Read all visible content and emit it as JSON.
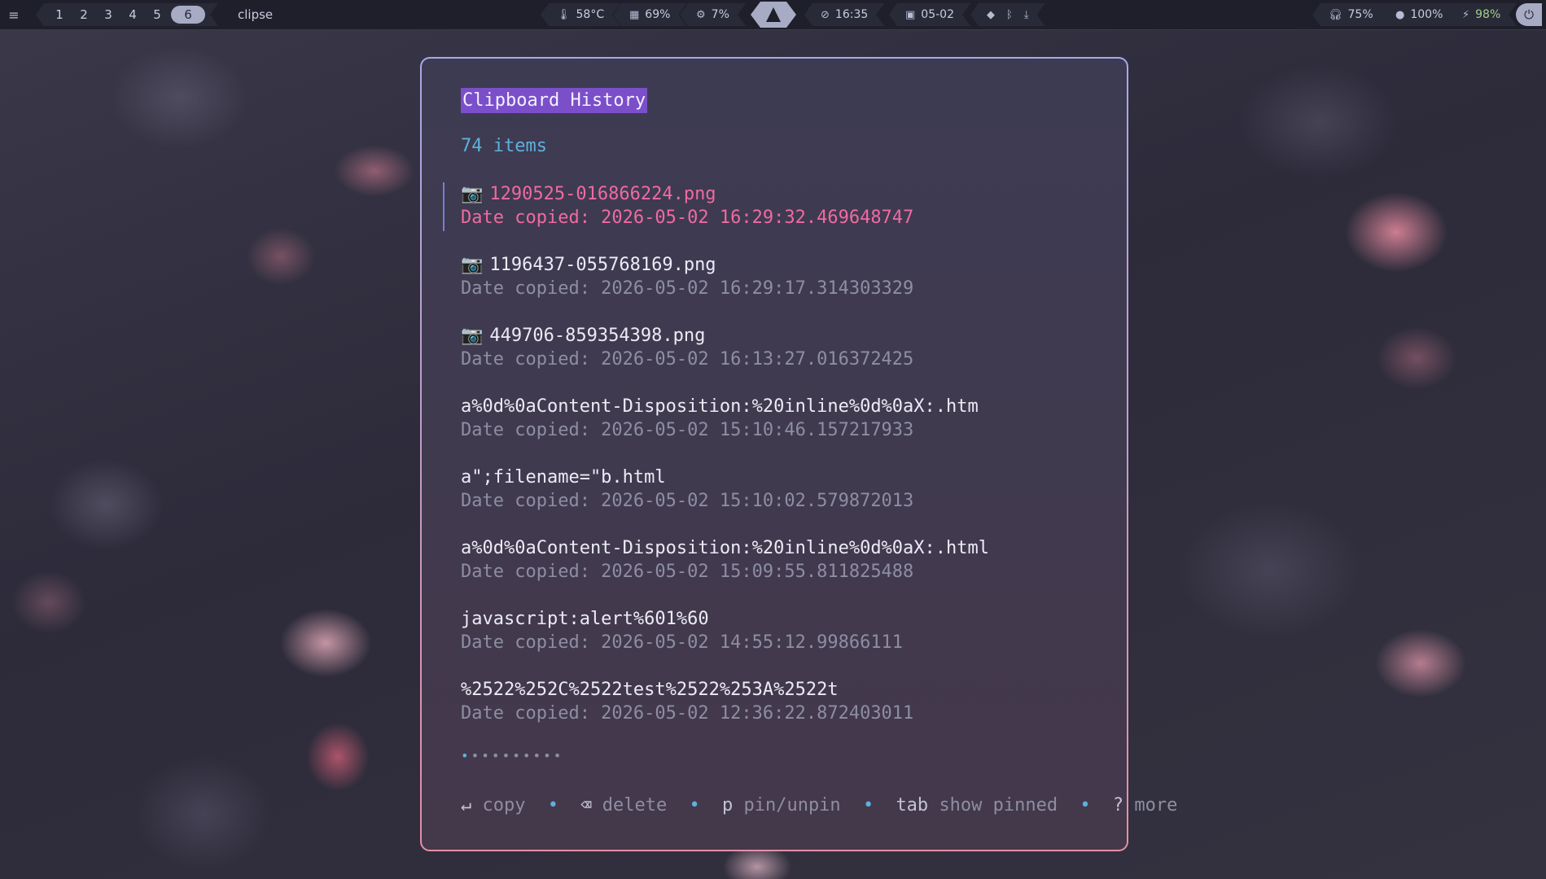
{
  "topbar": {
    "menu_icon": "hamburger-menu-icon",
    "workspaces": [
      "1",
      "2",
      "3",
      "4",
      "5",
      "6"
    ],
    "active_workspace": "6",
    "window_title": "clipse",
    "temperature": "58°C",
    "memory": "69%",
    "cpu": "7%",
    "time": "16:35",
    "date": "05-02",
    "headphones": "75%",
    "volume": "100%",
    "battery": "98%"
  },
  "clipboard": {
    "title": "Clipboard History",
    "count_label": "74 items",
    "entries": [
      {
        "icon": "📷",
        "text": "1290525-016866224.png",
        "date": "Date copied: 2026-05-02 16:29:32.469648747",
        "selected": true
      },
      {
        "icon": "📷",
        "text": "1196437-055768169.png",
        "date": "Date copied: 2026-05-02 16:29:17.314303329"
      },
      {
        "icon": "📷",
        "text": "449706-859354398.png",
        "date": "Date copied: 2026-05-02 16:13:27.016372425"
      },
      {
        "icon": "",
        "text": "a%0d%0aContent-Disposition:%20inline%0d%0aX:.htm",
        "date": "Date copied: 2026-05-02 15:10:46.157217933"
      },
      {
        "icon": "",
        "text": "a\";filename=\"b.html",
        "date": "Date copied: 2026-05-02 15:10:02.579872013"
      },
      {
        "icon": "",
        "text": "a%0d%0aContent-Disposition:%20inline%0d%0aX:.html",
        "date": "Date copied: 2026-05-02 15:09:55.811825488"
      },
      {
        "icon": "",
        "text": "javascript:alert%601%60",
        "date": "Date copied: 2026-05-02 14:55:12.99866111"
      },
      {
        "icon": "",
        "text": "%2522%252C%2522test%2522%253A%2522t",
        "date": "Date copied: 2026-05-02 12:36:22.872403011"
      }
    ],
    "pagination": {
      "total_pages": 10,
      "current_page": 1
    },
    "help": {
      "copy_key": "↵",
      "copy": "copy",
      "delete_key": "⌫",
      "delete": "delete",
      "pin_key": "p",
      "pin": "pin/unpin",
      "tab_key": "tab",
      "tab": "show pinned",
      "more_key": "?",
      "more": "more",
      "separator": "•"
    }
  }
}
